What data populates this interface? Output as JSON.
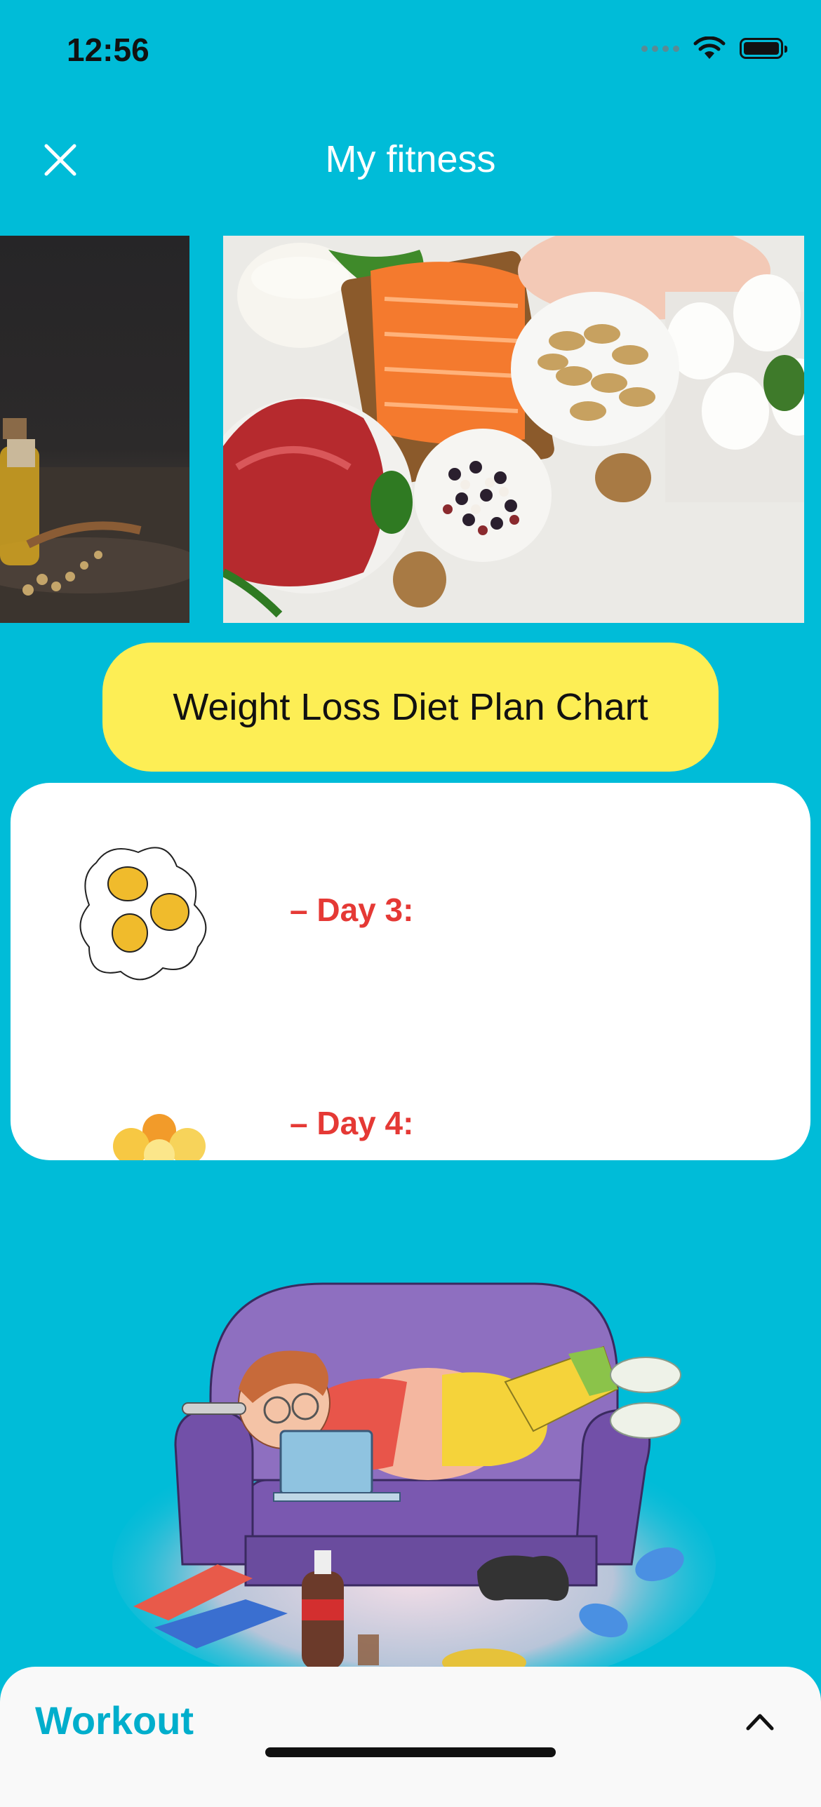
{
  "status_bar": {
    "time": "12:56",
    "icons": [
      "cellular-signal-icon",
      "wifi-icon",
      "battery-icon"
    ]
  },
  "header": {
    "title": "My fitness",
    "close_icon": "close-icon"
  },
  "carousel": {
    "slides": [
      {
        "name": "oil-and-seeds-photo"
      },
      {
        "name": "protein-foods-photo"
      }
    ]
  },
  "plan_button": {
    "label": "Weight Loss Diet Plan Chart"
  },
  "day_list": {
    "items": [
      {
        "label": "– Day 3:",
        "icon": "fried-eggs-icon"
      },
      {
        "label": "– Day 4:",
        "icon": "citrus-fruits-icon"
      }
    ]
  },
  "bottom_sheet": {
    "title": "Workout",
    "toggle_icon": "chevron-up-icon"
  },
  "colors": {
    "background": "#00BCD8",
    "pill": "#FDEE55",
    "day_label": "#E53935",
    "workout_label": "#00AECC"
  }
}
